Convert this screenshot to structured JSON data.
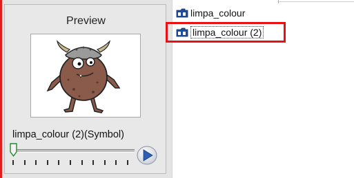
{
  "preview": {
    "title": "Preview",
    "symbol_label": "limpa_colour (2)(Symbol)",
    "slider_value": 0,
    "tick_count": 11,
    "play_icon": "play-icon"
  },
  "library_list": {
    "items": [
      {
        "label": "limpa_colour",
        "icon": "symbol-folder-icon",
        "selected": false
      },
      {
        "label": "limpa_colour (2)",
        "icon": "symbol-folder-icon",
        "selected": true
      }
    ]
  },
  "colors": {
    "highlight_red": "#e81010",
    "icon_blue": "#1d4e9e"
  }
}
